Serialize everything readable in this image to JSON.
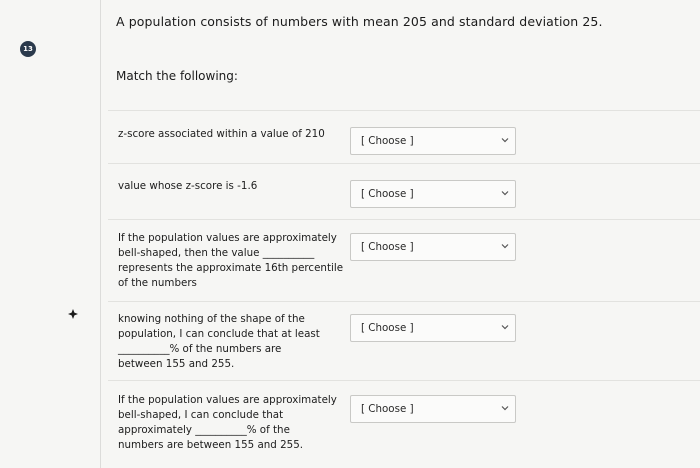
{
  "question": {
    "number": "13",
    "text": "A population consists of numbers with mean 205 and standard deviation 25."
  },
  "instruction": "Match the following:",
  "items": [
    {
      "lines": [
        "z-score associated within a value of 210"
      ],
      "select_value": "[ Choose ]"
    },
    {
      "lines": [
        "value whose z-score is -1.6"
      ],
      "select_value": "[ Choose ]"
    },
    {
      "lines": [
        "If the population values are approximately",
        "bell-shaped, then the value __________",
        "represents the approximate 16th percentile",
        "of the numbers"
      ],
      "select_value": "[ Choose ]"
    },
    {
      "lines": [
        "knowing nothing of the shape of the",
        "population, I can conclude that at least",
        "__________% of the numbers are",
        "between 155 and 255."
      ],
      "select_value": "[ Choose ]"
    },
    {
      "lines": [
        "If the population values are approximately",
        "bell-shaped, I can conclude that",
        "approximately __________% of the",
        "numbers are between 155 and 255."
      ],
      "select_value": "[ Choose ]"
    }
  ],
  "icons": {
    "badge": "question-number-badge",
    "chevron": "chevron-down-icon",
    "cursor": "mouse-cursor-icon"
  }
}
